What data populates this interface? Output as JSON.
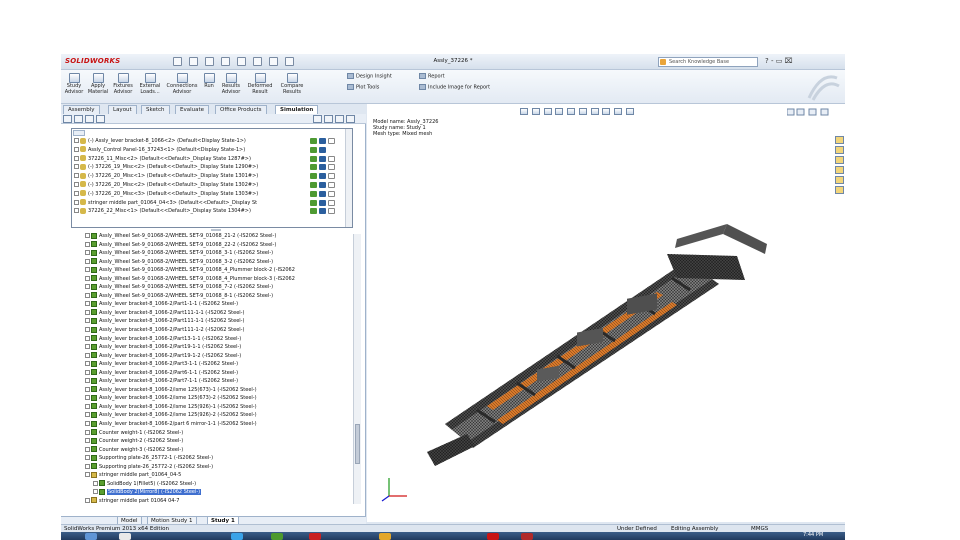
{
  "app": {
    "logo_text": "SOLIDWORKS",
    "document_title": "Assly_37226 *",
    "search_placeholder": "Search Knowledge Base",
    "window_controls": "? - ▭ ⌧"
  },
  "ribbon": {
    "buttons": [
      {
        "line1": "Study",
        "line2": "Advisor"
      },
      {
        "line1": "Apply",
        "line2": "Material"
      },
      {
        "line1": "Fixtures",
        "line2": "Advisor"
      },
      {
        "line1": "External",
        "line2": "Loads..."
      },
      {
        "line1": "Connections",
        "line2": "Advisor"
      },
      {
        "line1": "Run",
        "line2": ""
      },
      {
        "line1": "Results",
        "line2": "Advisor"
      },
      {
        "line1": "Deformed",
        "line2": "Result"
      },
      {
        "line1": "Compare",
        "line2": "Results"
      }
    ],
    "design_insight": "Design Insight",
    "plot_tools": "Plot Tools",
    "report": "Report",
    "include_image": "Include Image for Report"
  },
  "tabs": [
    "Assembly",
    "Layout",
    "Sketch",
    "Evaluate",
    "Office Products",
    "Simulation"
  ],
  "active_tab": "Simulation",
  "assembly_items": [
    "(-) Assly_lever bracket-8_1066<2> (Default<Display State-1>)",
    "Assly_Control Panel-16_37243<1> (Default<Display State-1>)",
    "37226_11_Misc<2> (Default<<Default>_Display State 1287#>)",
    "(-) 37226_19_Misc<2> (Default<<Default>_Display State 1290#>)",
    "(-) 37226_20_Misc<1> (Default<<Default>_Display State 1301#>)",
    "(-) 37226_20_Misc<2> (Default<<Default>_Display State 1302#>)",
    "(-) 37226_20_Misc<3> (Default<<Default>_Display State 1303#>)",
    "stringer middle part_01064_04<3> (Default<<Default>_Display St",
    "37226_22_Misc<1> (Default<<Default>_Display State 1304#>)"
  ],
  "mesh_items": [
    "Assly_Wheel Set-9_01068-2/WHEEL SET-9_01068_21-2 (-IS2062 Steel-)",
    "Assly_Wheel Set-9_01068-2/WHEEL SET-9_01068_22-2 (-IS2062 Steel-)",
    "Assly_Wheel Set-9_01068-2/WHEEL SET-9_01068_3-1 (-IS2062 Steel-)",
    "Assly_Wheel Set-9_01068-2/WHEEL SET-9_01068_3-2 (-IS2062 Steel-)",
    "Assly_Wheel Set-9_01068-2/WHEEL SET-9_01068_4_Plummer block-2 (-IS2062",
    "Assly_Wheel Set-9_01068-2/WHEEL SET-9_01068_4_Plummer block-3 (-IS2062",
    "Assly_Wheel Set-9_01068-2/WHEEL SET-9_01068_7-2 (-IS2062 Steel-)",
    "Assly_Wheel Set-9_01068-2/WHEEL SET-9_01068_8-1 (-IS2062 Steel-)",
    "Assly_lever bracket-8_1066-2/Part1-1-1 (-IS2062 Steel-)",
    "Assly_lever bracket-8_1066-2/Part111-1-1 (-IS2062 Steel-)",
    "Assly_lever bracket-8_1066-2/Part111-1-1 (-IS2062 Steel-)",
    "Assly_lever bracket-8_1066-2/Part111-1-2 (-IS2062 Steel-)",
    "Assly_lever bracket-8_1066-2/Part13-1-1 (-IS2062 Steel-)",
    "Assly_lever bracket-8_1066-2/Part19-1-1 (-IS2062 Steel-)",
    "Assly_lever bracket-8_1066-2/Part19-1-2 (-IS2062 Steel-)",
    "Assly_lever bracket-8_1066-2/Part3-1-1 (-IS2062 Steel-)",
    "Assly_lever bracket-8_1066-2/Part6-1-1 (-IS2062 Steel-)",
    "Assly_lever bracket-8_1066-2/Part7-1-1 (-IS2062 Steel-)",
    "Assly_lever bracket-8_1066-2/isme 125(673)-1 (-IS2062 Steel-)",
    "Assly_lever bracket-8_1066-2/isme 125(673)-2 (-IS2062 Steel-)",
    "Assly_lever bracket-8_1066-2/isme 125(926)-1 (-IS2062 Steel-)",
    "Assly_lever bracket-8_1066-2/isme 125(926)-2 (-IS2062 Steel-)",
    "Assly_lever bracket-8_1066-2/part 6 mirror-1-1 (-IS2062 Steel-)",
    "Counter weight-1 (-IS2062 Steel-)",
    "Counter weight-2 (-IS2062 Steel-)",
    "Counter weight-3 (-IS2062 Steel-)",
    "Supporting plate-26_25772-1 (-IS2062 Steel-)",
    "Supporting plate-26_25772-2 (-IS2062 Steel-)",
    "stringer middle part_01064_04-5",
    "SolidBody 1(Fillet5) (-IS2062 Steel-)",
    "SolidBody 2(Mirror8) (-IS2062 Steel-)",
    "stringer middle part 01064 04-7"
  ],
  "selected_mesh_index": 30,
  "bottom_tabs": [
    "Model",
    "Motion Study 1",
    "Study 1"
  ],
  "active_bottom_tab": "Study 1",
  "viewport": {
    "model_name": "Model name: Assly_37226",
    "study_name": "Study name: Study 1",
    "mesh_type": "Mesh type: Mixed mesh"
  },
  "status": {
    "edition": "SolidWorks Premium 2013 x64 Edition",
    "definition": "Under Defined",
    "mode": "Editing Assembly",
    "units": "MMGS",
    "clock": "7:44 PM"
  },
  "colors": {
    "accent_red": "#c81414",
    "mesh_dark": "#3a3a3a",
    "mesh_orange": "#d9792b",
    "selection": "#3f6fcf"
  }
}
